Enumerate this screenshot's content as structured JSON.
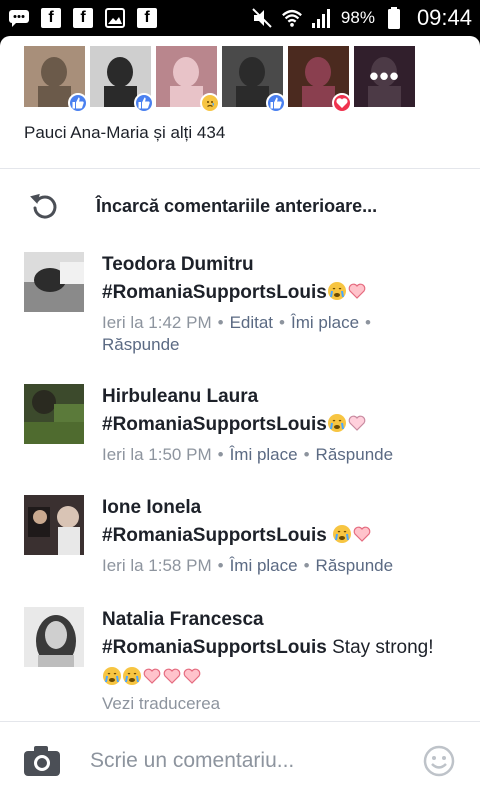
{
  "status_bar": {
    "battery_percent": "98%",
    "time": "09:44",
    "icons": [
      "message-icon",
      "facebook-icon",
      "facebook-icon",
      "gallery-icon",
      "facebook-icon",
      "mute-icon",
      "wifi-icon",
      "signal-icon",
      "battery-icon"
    ]
  },
  "reactors": [
    {
      "reaction": "like",
      "tones": [
        "#6b5a4a",
        "#a88f7a"
      ]
    },
    {
      "reaction": "like",
      "tones": [
        "#2a2a2a",
        "#cfcfcf"
      ]
    },
    {
      "reaction": "sad",
      "tones": [
        "#e8c3c8",
        "#b9868d"
      ]
    },
    {
      "reaction": "like",
      "tones": [
        "#2b2b2b",
        "#4a4a4a"
      ]
    },
    {
      "reaction": "love",
      "tones": [
        "#8a3f4f",
        "#4b2a1f"
      ]
    },
    {
      "reaction": "more",
      "tones": [
        "#8a6a80",
        "#5a3a50"
      ]
    }
  ],
  "more_label": "•••",
  "reactions_summary": "Pauci Ana-Maria și alți 434",
  "load_previous_label": "Încarcă comentariile anterioare...",
  "comments": [
    {
      "author": "Teodora Dumitru",
      "hashtag": "#RomaniaSupportsLouis",
      "text_after": "",
      "timestamp": "Ieri la 1:42 PM",
      "actions": [
        "Editat",
        "Îmi place",
        "Răspunde"
      ]
    },
    {
      "author": "Hirbuleanu Laura",
      "hashtag": "#RomaniaSupportsLouis",
      "text_after": "",
      "timestamp": "Ieri la 1:50 PM",
      "actions": [
        "Îmi place",
        "Răspunde"
      ]
    },
    {
      "author": "Ione Ionela",
      "hashtag": "#RomaniaSupportsLouis",
      "text_after": "",
      "timestamp": "Ieri la 1:58 PM",
      "actions": [
        "Îmi place",
        "Răspunde"
      ]
    },
    {
      "author": "Natalia Francesca",
      "hashtag": "#RomaniaSupportsLouis",
      "text_after": " Stay strong!",
      "timestamp": "",
      "actions": [],
      "translate_label": "Vezi traducerea"
    }
  ],
  "composer": {
    "placeholder": "Scrie un comentariu..."
  },
  "colors": {
    "like": "#4a80f0",
    "love": "#f0334f",
    "action_text": "#5b6a83",
    "meta_text": "#8d949e"
  }
}
